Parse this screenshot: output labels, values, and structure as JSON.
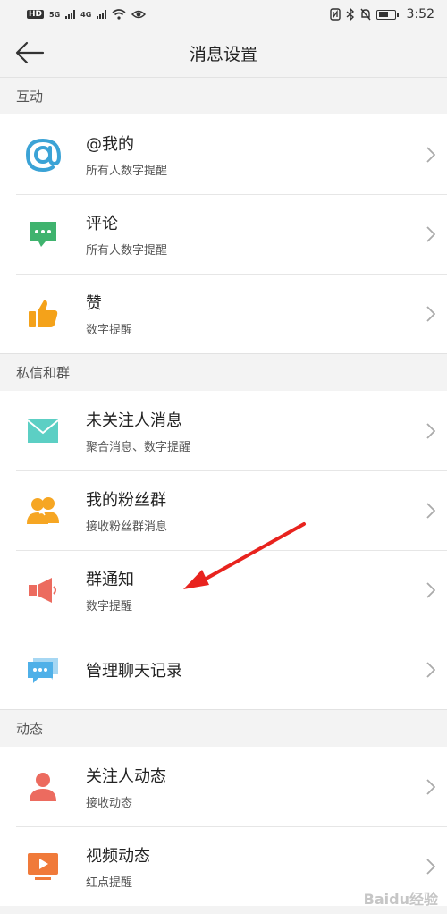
{
  "status_bar": {
    "left_tag": "HD",
    "net1": "5G",
    "net2": "4G",
    "time": "3:52",
    "icons": [
      "sim-icon",
      "signal-icon",
      "wifi-icon",
      "eye-icon",
      "nfc-icon",
      "bluetooth-icon",
      "mute-icon",
      "battery-icon"
    ]
  },
  "header": {
    "title": "消息设置",
    "back_icon": "arrow-left-icon"
  },
  "sections": [
    {
      "label": "互动",
      "items": [
        {
          "title": "@我的",
          "subtitle": "所有人数字提醒",
          "icon": "at-icon",
          "color": "#3ba3d6"
        },
        {
          "title": "评论",
          "subtitle": "所有人数字提醒",
          "icon": "comment-icon",
          "color": "#3fb36e"
        },
        {
          "title": "赞",
          "subtitle": "数字提醒",
          "icon": "thumbs-up-icon",
          "color": "#f4a21a"
        }
      ]
    },
    {
      "label": "私信和群",
      "items": [
        {
          "title": "未关注人消息",
          "subtitle": "聚合消息、数字提醒",
          "icon": "mail-icon",
          "color": "#5ccfc4"
        },
        {
          "title": "我的粉丝群",
          "subtitle": "接收粉丝群消息",
          "icon": "fans-group-icon",
          "color": "#f6a623"
        },
        {
          "title": "群通知",
          "subtitle": "数字提醒",
          "icon": "megaphone-icon",
          "color": "#ec6b5f"
        },
        {
          "title": "管理聊天记录",
          "subtitle": "",
          "icon": "chat-icon",
          "color": "#4fb0e8"
        }
      ]
    },
    {
      "label": "动态",
      "items": [
        {
          "title": "关注人动态",
          "subtitle": "接收动态",
          "icon": "person-icon",
          "color": "#ec6b5f"
        },
        {
          "title": "视频动态",
          "subtitle": "红点提醒",
          "icon": "video-icon",
          "color": "#f07a3a"
        }
      ]
    }
  ],
  "annotation": {
    "color": "#e8231e"
  },
  "watermark": "Baidu经验"
}
